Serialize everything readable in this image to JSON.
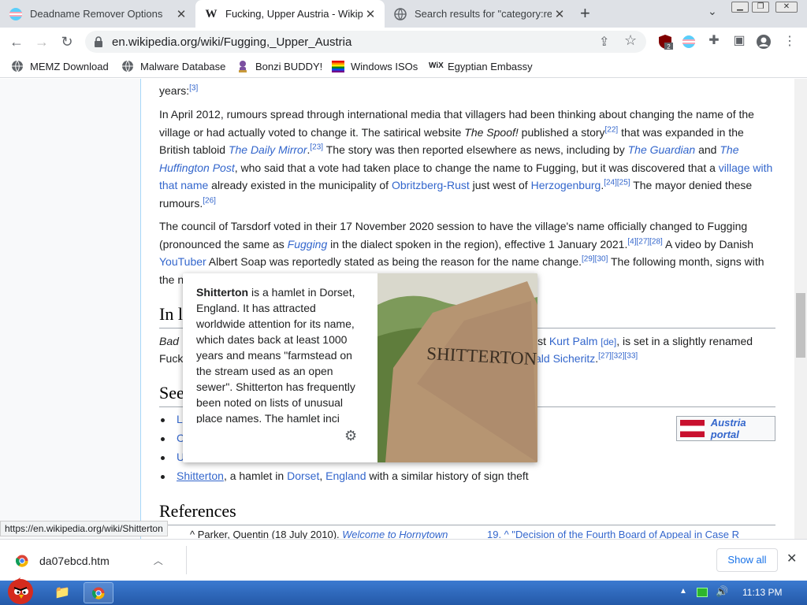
{
  "tabs": [
    {
      "title": "Deadname Remover Options",
      "icon": "trans-flag-icon"
    },
    {
      "title": "Fucking, Upper Austria - Wikip",
      "icon": "wikipedia-icon"
    },
    {
      "title": "Search results for \"category:re",
      "icon": "globe-icon"
    }
  ],
  "toolbar": {
    "url": "en.wikipedia.org/wiki/Fugging,_Upper_Austria",
    "ext_badge": "2"
  },
  "bookmarks": [
    {
      "label": "MEMZ Download",
      "icon": "globe-icon"
    },
    {
      "label": "Malware Database",
      "icon": "globe-icon"
    },
    {
      "label": "Bonzi BUDDY!",
      "icon": "bonzi-icon"
    },
    {
      "label": "Windows ISOs",
      "icon": "windows-icon"
    },
    {
      "label": "Egyptian Embassy",
      "icon": "wix-icon"
    }
  ],
  "article": {
    "p0": "years:",
    "p0_ref": "[3]",
    "p1": {
      "a": "In April 2012, rumours spread through international media that villagers had been thinking about changing the name of the village or had actually voted to change it. The satirical website ",
      "spoof": "The Spoof!",
      "b": " published a story",
      "r22": "[22]",
      "c": " that was expanded in the British tabloid ",
      "mirror": "The Daily Mirror",
      "r23": "[23]",
      "d": " The story was then reported elsewhere as news, including by ",
      "guardian": "The Guardian",
      "e": " and ",
      "huff": "The Huffington Post",
      "f": ", who said that a vote had taken place to change the name to Fugging, but it was discovered that a ",
      "village": "village with that name",
      "g": " already existed in the municipality of ",
      "obr": "Obritzberg-Rust",
      "h": " just west of ",
      "herz": "Herzogenburg",
      "r24": "[24][25]",
      "i": " The mayor denied these rumours.",
      "r26": "[26]"
    },
    "p2": {
      "a": "The council of Tarsdorf voted in their 17 November 2020 session to have the village's name officially changed to Fugging (pronounced the same as ",
      "fugging": "Fugging",
      "b": " in the dialect spoken in the region), effective 1 January 2021.",
      "r4": "[4][27][28]",
      "c": " A video by Danish ",
      "yt": "YouTuber",
      "d": " Albert Soap was reportedly stated as being the reason for the name change.",
      "r29": "[29][30]",
      "e": " The following month, signs with the n"
    },
    "h2_in": "In l",
    "p3_a": "Bad",
    "p3_b": "ist ",
    "p3_kurt": "Kurt Palm",
    "p3_de": "[de]",
    "p3_c": ", is set in a slightly renamed",
    "p3_d": "Fuck",
    "p3_e": "ald Sicheritz",
    "p3_refs": "[27][32][33]",
    "h2_see": "See",
    "bullets": [
      "L",
      "C",
      "U"
    ],
    "last_bullet": {
      "link": "Shitterton",
      "a": ", a hamlet in ",
      "dorset": "Dorset",
      "sep": ", ",
      "england": "England",
      "b": " with a similar history of sign theft"
    },
    "portal": "Austria portal",
    "h2_refs": "References",
    "ref18": "^ Parker, Quentin (18 July 2010). ",
    "ref18_it": "Welcome to Hornytown",
    "ref19": "19. ^ \"Decision of the Fourth Board of Appeal in Case R"
  },
  "popup": {
    "bold": "Shitterton",
    "text": " is a hamlet in Dorset, England. It has attracted worldwide attention for its name, which dates back at least 1000 years and means \"farmstead on the stream used as an open sewer\". Shitterton has frequently been noted on lists of unusual place names. The hamlet inci",
    "stone_text": "SHITTERTON"
  },
  "status_url": "https://en.wikipedia.org/wiki/Shitterton",
  "download": {
    "filename": "da07ebcd.htm",
    "show_all": "Show all"
  },
  "taskbar": {
    "time": "11:13 PM"
  }
}
